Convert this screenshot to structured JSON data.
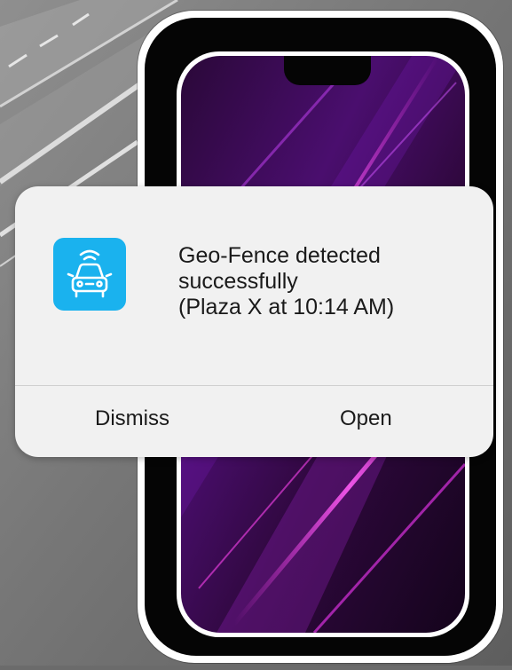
{
  "notification": {
    "app_icon": "connected-car-icon",
    "message_lines": [
      "Geo-Fence detected",
      "successfully",
      "(Plaza X at 10:14 AM)"
    ],
    "actions": {
      "dismiss_label": "Dismiss",
      "open_label": "Open"
    }
  },
  "colors": {
    "icon_background": "#1ab2ee",
    "card_background": "#f1f1f1",
    "screen_wallpaper": "#3a0a5c"
  }
}
